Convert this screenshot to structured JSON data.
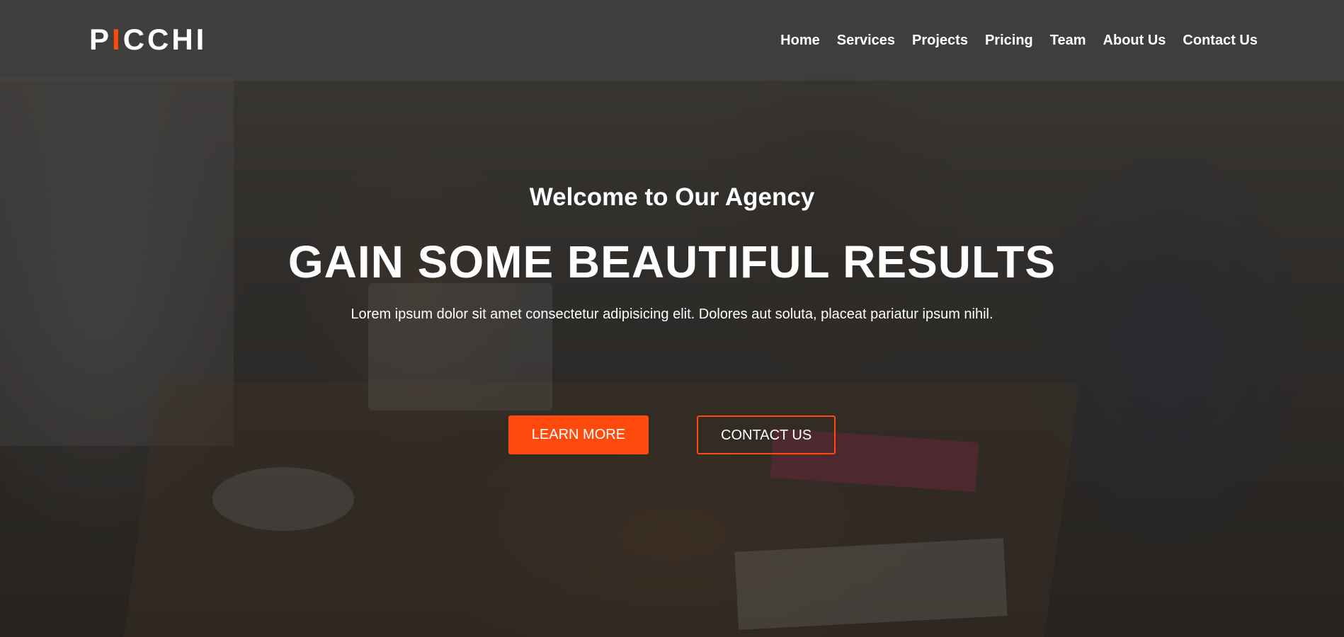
{
  "brand": {
    "logo_prefix": "P",
    "logo_accent": "I",
    "logo_suffix": "CCHI",
    "accent_color": "#ff4a0d"
  },
  "nav": {
    "items": [
      {
        "label": "Home"
      },
      {
        "label": "Services"
      },
      {
        "label": "Projects"
      },
      {
        "label": "Pricing"
      },
      {
        "label": "Team"
      },
      {
        "label": "About Us"
      },
      {
        "label": "Contact Us"
      }
    ]
  },
  "hero": {
    "subtitle": "Welcome to Our Agency",
    "headline": "GAIN SOME BEAUTIFUL RESULTS",
    "lead": "Lorem ipsum dolor sit amet consectetur adipisicing elit. Dolores aut soluta, placeat pariatur ipsum nihil.",
    "primary_button": "LEARN MORE",
    "secondary_button": "CONTACT US"
  }
}
